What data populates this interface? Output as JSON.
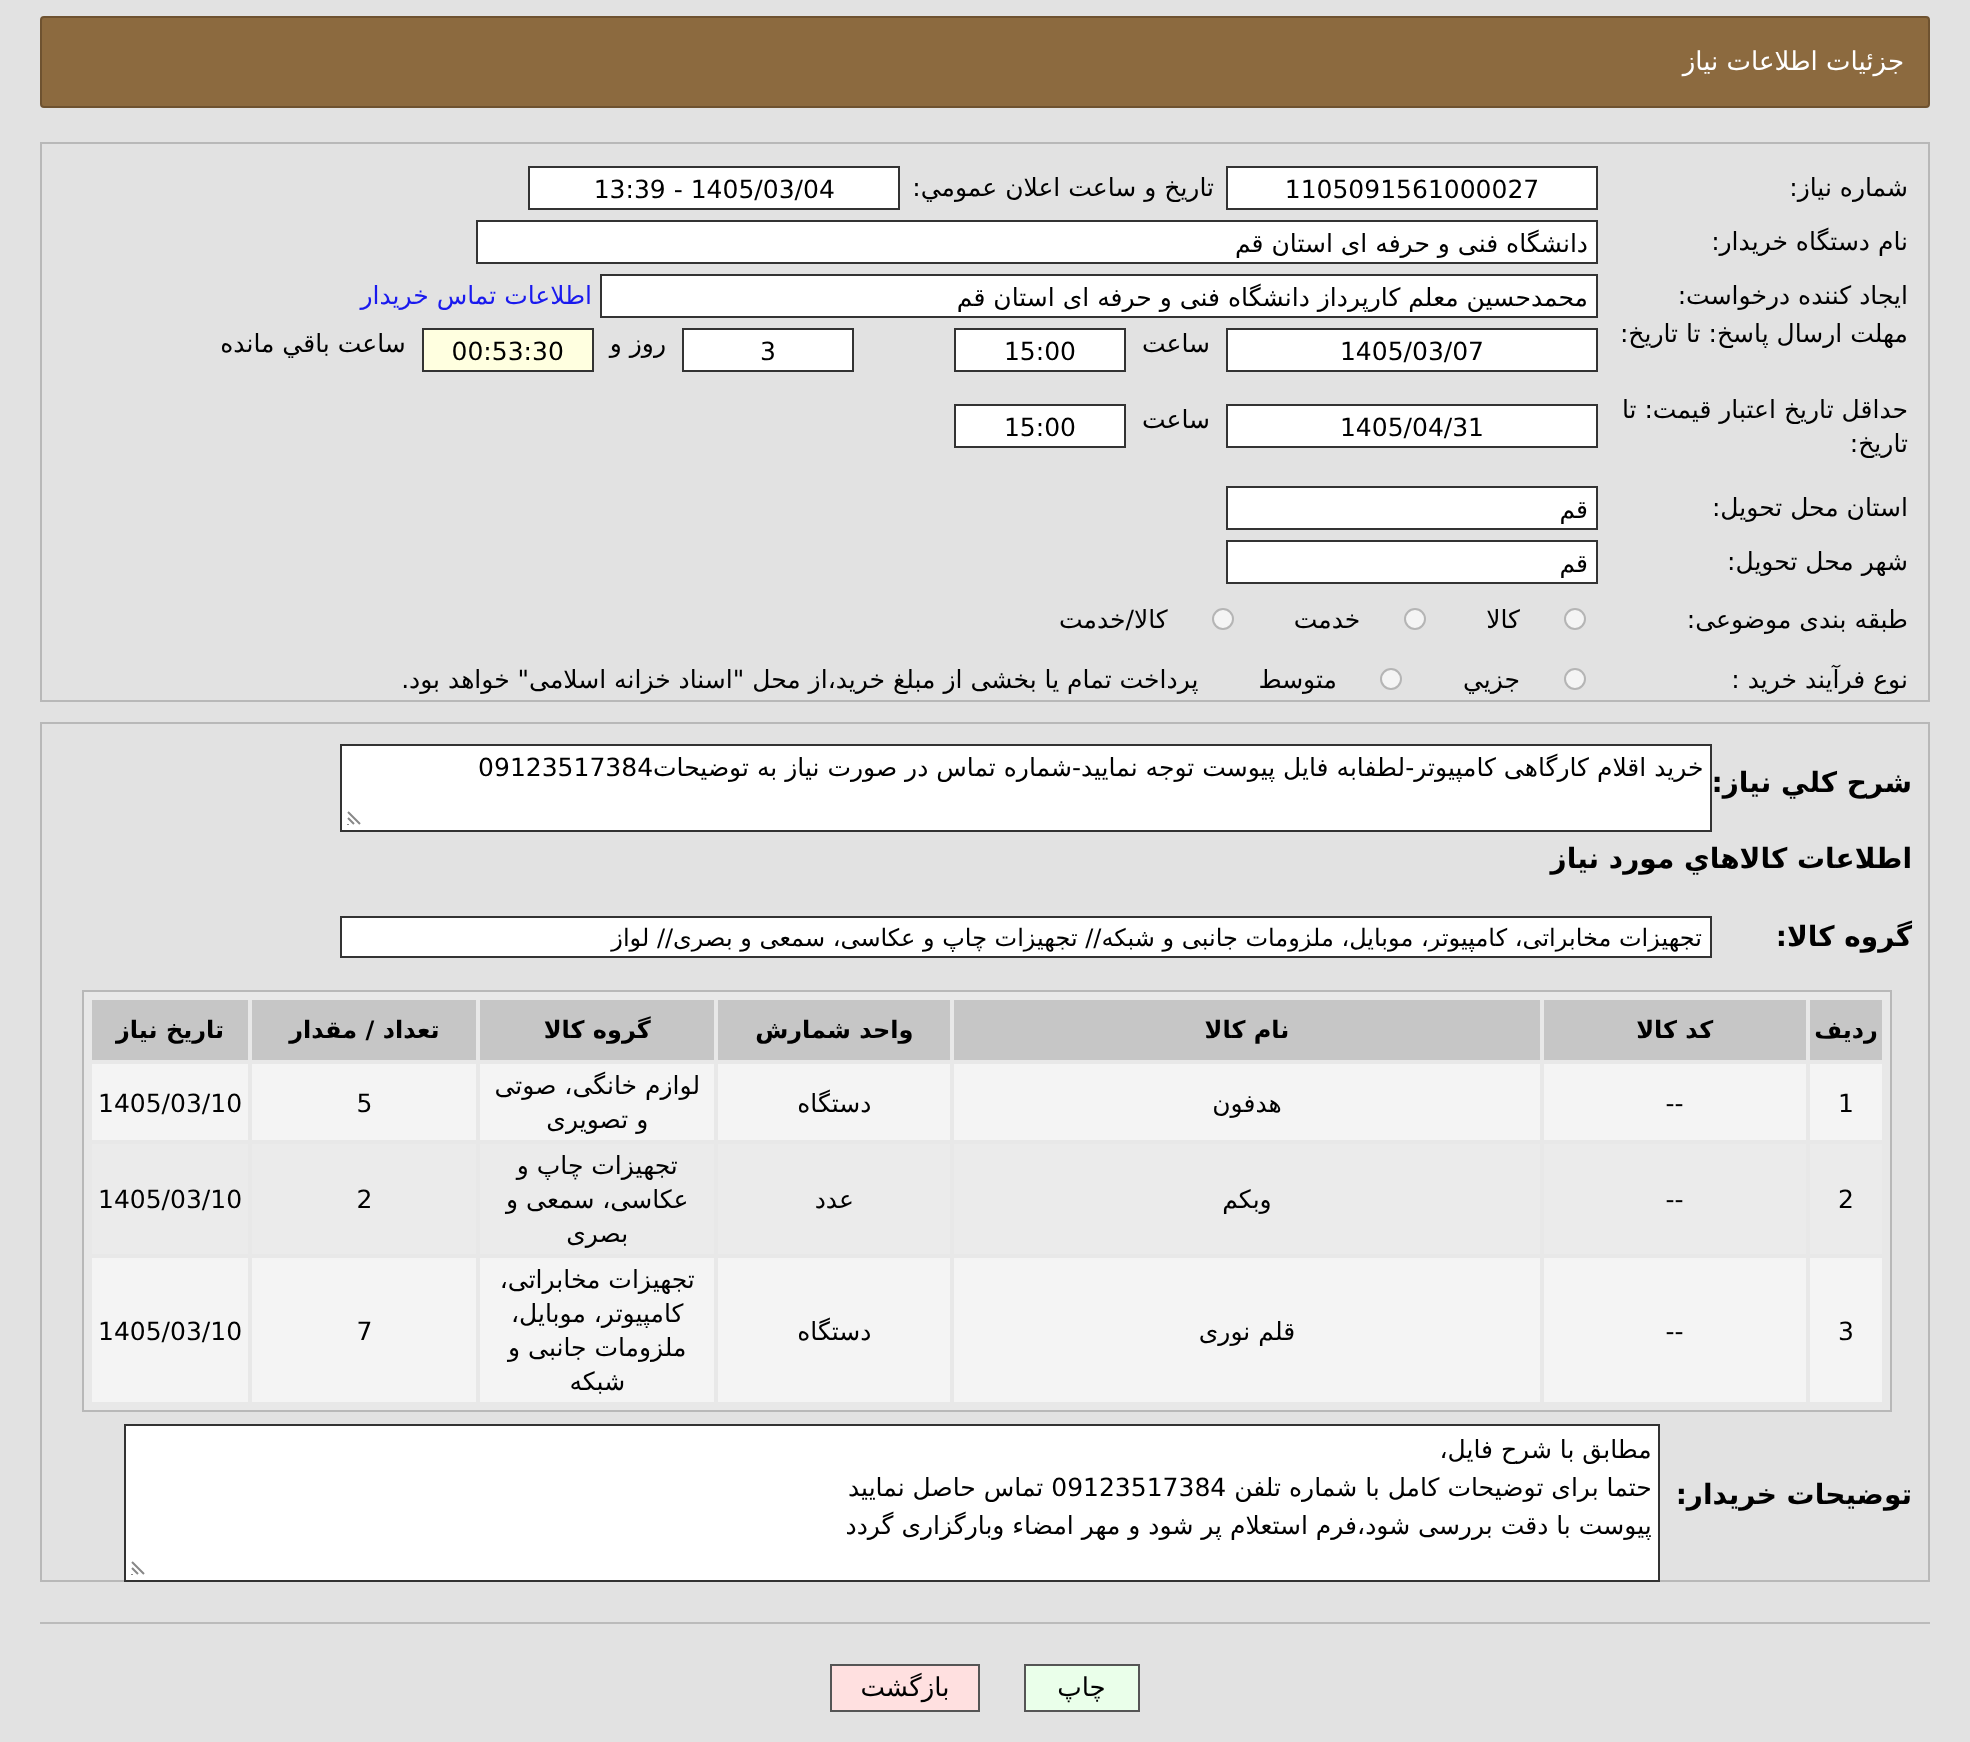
{
  "header": {
    "title": "جزئیات اطلاعات نیاز"
  },
  "details": {
    "need_number": {
      "label": "شماره نیاز:",
      "value": "1105091561000027"
    },
    "announce": {
      "label": "تاریخ و ساعت اعلان عمومي:",
      "value": "1405/03/04 - 13:39"
    },
    "buyer": {
      "label": "نام دستگاه خریدار:",
      "value": "دانشگاه فنی و حرفه ای استان قم"
    },
    "requester": {
      "label": "ایجاد کننده درخواست:",
      "value": "محمدحسین معلم کارپرداز دانشگاه فنی و حرفه ای استان قم",
      "link": "اطلاعات تماس خریدار"
    },
    "deadline": {
      "label": "مهلت ارسال پاسخ: تا تاریخ:",
      "date": "1405/03/07",
      "time_label": "ساعت",
      "time": "15:00",
      "days": "3",
      "days_label": "روز و",
      "remaining": "00:53:30",
      "remaining_label": "ساعت باقي مانده"
    },
    "validity": {
      "label": "حداقل تاریخ اعتبار قیمت: تا تاریخ:",
      "date": "1405/04/31",
      "time_label": "ساعت",
      "time": "15:00"
    },
    "province": {
      "label": "استان محل تحویل:",
      "value": "قم"
    },
    "city": {
      "label": "شهر محل تحویل:",
      "value": "قم"
    },
    "category": {
      "label": "طبقه بندی موضوعی:",
      "options": [
        {
          "label": "کالا",
          "selected": false
        },
        {
          "label": "خدمت",
          "selected": false
        },
        {
          "label": "کالا/خدمت",
          "selected": false
        }
      ]
    },
    "process": {
      "label": "نوع فرآیند خرید :",
      "options": [
        {
          "label": "جزيي",
          "selected": false
        },
        {
          "label": "متوسط",
          "selected": false
        }
      ],
      "note": "پرداخت تمام یا بخشی از مبلغ خرید،از محل \"اسناد خزانه اسلامی\" خواهد بود."
    }
  },
  "description": {
    "label": "شرح کلي نیاز:",
    "value": "خرید اقلام کارگاهی کامپیوتر-لطفابه فایل پیوست توجه نمایید-شماره تماس در صورت نیاز به توضیحات09123517384"
  },
  "goods_title": "اطلاعات کالاهاي مورد نیاز",
  "goods_group": {
    "label": "گروه کالا:",
    "value": "تجهیزات مخابراتی، کامپیوتر، موبایل، ملزومات جانبی و شبکه// تجهیزات چاپ و عکاسی، سمعی و بصری// لواز"
  },
  "table": {
    "columns": [
      "ردیف",
      "کد کالا",
      "نام کالا",
      "واحد شمارش",
      "گروه کالا",
      "تعداد / مقدار",
      "تاریخ نیاز"
    ],
    "rows": [
      [
        "1",
        "--",
        "هدفون",
        "دستگاه",
        "لوازم خانگی، صوتی و تصویری",
        "5",
        "1405/03/10"
      ],
      [
        "2",
        "--",
        "وبکم",
        "عدد",
        "تجهیزات چاپ و عکاسی، سمعی و بصری",
        "2",
        "1405/03/10"
      ],
      [
        "3",
        "--",
        "قلم نوری",
        "دستگاه",
        "تجهیزات مخابراتی، کامپیوتر، موبایل، ملزومات جانبی و شبکه",
        "7",
        "1405/03/10"
      ]
    ]
  },
  "buyer_notes": {
    "label": "توضیحات خریدار:",
    "lines": [
      "مطابق با شرح فایل،",
      "حتما برای توضیحات کامل با شماره تلفن 09123517384 تماس حاصل نمایید",
      "پیوست با دقت بررسی شود،فرم استعلام پر شود و مهر امضاء وبارگزاری گردد"
    ]
  },
  "buttons": [
    {
      "label": "چاپ",
      "kind": "print"
    },
    {
      "label": "بازگشت",
      "kind": "back"
    }
  ]
}
